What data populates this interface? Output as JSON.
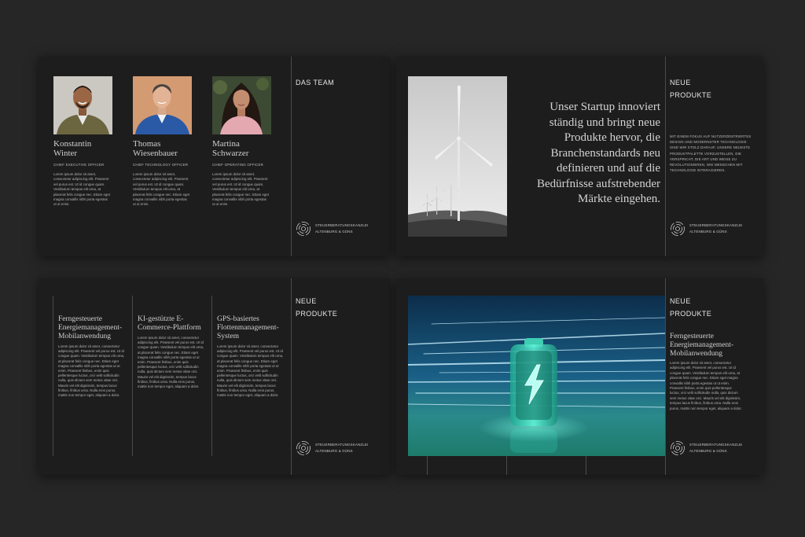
{
  "slide1": {
    "heading": "DAS TEAM",
    "members": [
      {
        "name": "Konstantin Winter",
        "role": "CHIEF EXECUTIVE OFFICER",
        "text": "Lorem ipsum dolor sit amet, consectetur adipiscing elit. Praesent vel purus est. Ut id congue quam. Vestibulum tempus elit urna, at placerat felis congue nec. Etiam eget magna convallis nibh porta egestas ut ut enim."
      },
      {
        "name": "Thomas Wiesenbauer",
        "role": "CHIEF TECHNOLOGY OFFICER",
        "text": "Lorem ipsum dolor sit amet, consectetur adipiscing elit. Praesent vel purus est. Ut id congue quam. Vestibulum tempus elit urna, at placerat felis congue nec. Etiam eget magna convallis nibh porta egestas ut ut enim."
      },
      {
        "name": "Martina Schwarzer",
        "role": "CHIEF OPERATING OFFICER",
        "text": "Lorem ipsum dolor sit amet, consectetur adipiscing elit. Praesent vel purus est. Ut id congue quam. Vestibulum tempus elit urna, at placerat felis congue nec. Etiam eget magna convallis nibh porta egestas ut ut enim."
      }
    ]
  },
  "slide2": {
    "heading_line1": "NEUE",
    "heading_line2": "PRODUKTE",
    "quote": "Unser Startup innoviert ständig und bringt neue Produkte hervor, die Branchenstandards neu definieren und auf die Bedürfnisse aufstrebender Märkte eingehen.",
    "caps_text": "MIT EINEM FOKUS AUF NUTZERZENTRIERTES DESIGN UND MODERNSTER TECHNOLOGIE SIND WIR STOLZ DARAUF, UNSERE NEUESTE PRODUKTPALETTE VORZUSTELLEN, DIE VERSPRICHT, DIE ART UND WEISE ZU REVOLUTIONIEREN, WIE MENSCHEN MIT TECHNOLOGIE INTERAGIEREN."
  },
  "slide3": {
    "heading_line1": "NEUE",
    "heading_line2": "PRODUKTE",
    "columns": [
      {
        "title": "Ferngesteuerte Energiemanagement-Mobilanwendung",
        "text": "Lorem ipsum dolor sit amet, consectetur adipiscing elit. Praesent vel purus est. Ut id congue quam. Vestibulum tempus elit urna, at placerat felis congue nec. Etiam eget magna convallis nibh porta egestas ut ut enim. Praesent finibus, enim quis pellentesque luctus, orci velit sollicitudin nulla, quis dictum sem metus vitae orci. Mauris vel elit dignissim, tempus lacus finibus, finibus urna. Nulla eros purus, mattis non tempor eget, aliquam a dolor."
      },
      {
        "title": "KI-gestützte E-Commerce-Plattform",
        "text": "Lorem ipsum dolor sit amet, consectetur adipiscing elit. Praesent vel purus est. Ut id congue quam. Vestibulum tempus elit urna, at placerat felis congue nec. Etiam eget magna convallis nibh porta egestas ut ut enim. Praesent finibus, enim quis pellentesque luctus, orci velit sollicitudin nulla, quis dictum sem metus vitae orci. Mauris vel elit dignissim, tempus lacus finibus, finibus urna. Nulla eros purus, mattis non tempor eget, aliquam a dolor."
      },
      {
        "title": "GPS-basiertes Flottenmanagement-System",
        "text": "Lorem ipsum dolor sit amet, consectetur adipiscing elit. Praesent vel purus est. Ut id congue quam. Vestibulum tempus elit urna, at placerat felis congue nec. Etiam eget magna convallis nibh porta egestas ut ut enim. Praesent finibus, enim quis pellentesque luctus, orci velit sollicitudin nulla, quis dictum sem metus vitae orci. Mauris vel elit dignissim, tempus lacus finibus, finibus urna. Nulla eros purus, mattis non tempor eget, aliquam a dolor."
      }
    ]
  },
  "slide4": {
    "heading_line1": "NEUE",
    "heading_line2": "PRODUKTE",
    "title": "Ferngesteuerte Energiemanagement-Mobilanwendung",
    "text": "Lorem ipsum dolor sit amet, consectetur adipiscing elit. Praesent vel purus est. Ut id congue quam. Vestibulum tempus elit urna, at placerat felis congue nec. Etiam eget magna convallis nibh porta egestas ut ut enim. Praesent finibus, enim quis pellentesque luctus, orci velit sollicitudin nulla, quis dictum sem metus vitae orci. Mauris vel elit dignissim, tempus lacus finibus, finibus urna. Nulla eros purus, mattis non tempor eget, aliquam a dolor."
  },
  "logo": {
    "line1": "STEUERBERATUNGSKANZLEI",
    "line2": "ALTENBURG & GÜNS"
  },
  "colors": {
    "background": "#262626",
    "slide": "#1d1d1d",
    "divider": "#4a4a4a",
    "battery_glow": "#3ff0d0"
  }
}
